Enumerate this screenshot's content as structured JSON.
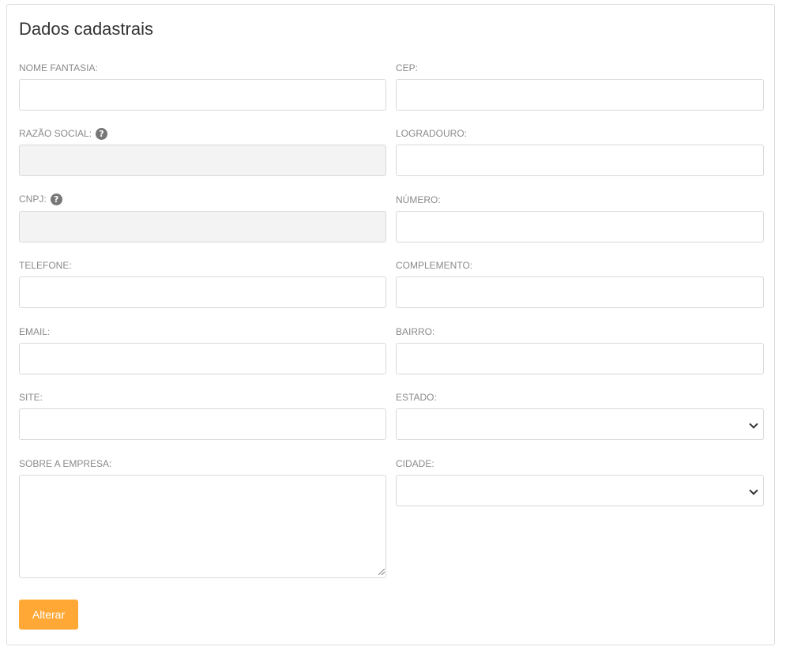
{
  "form": {
    "title": "Dados cadastrais",
    "submit_label": "Alterar",
    "left": {
      "nome_fantasia": {
        "label": "NOME FANTASIA:",
        "value": ""
      },
      "razao_social": {
        "label": "RAZÃO SOCIAL:",
        "value": "",
        "help_icon": "question-circle-icon"
      },
      "cnpj": {
        "label": "CNPJ:",
        "value": "",
        "help_icon": "question-circle-icon"
      },
      "telefone": {
        "label": "TELEFONE:",
        "value": ""
      },
      "email": {
        "label": "EMAIL:",
        "value": ""
      },
      "site": {
        "label": "SITE:",
        "value": ""
      },
      "sobre": {
        "label": "SOBRE A EMPRESA:",
        "value": ""
      }
    },
    "right": {
      "cep": {
        "label": "CEP:",
        "value": ""
      },
      "logradouro": {
        "label": "LOGRADOURO:",
        "value": ""
      },
      "numero": {
        "label": "NÚMERO:",
        "value": ""
      },
      "complemento": {
        "label": "COMPLEMENTO:",
        "value": ""
      },
      "bairro": {
        "label": "BAIRRO:",
        "value": ""
      },
      "estado": {
        "label": "ESTADO:",
        "selected": ""
      },
      "cidade": {
        "label": "CIDADE:",
        "selected": ""
      }
    }
  },
  "colors": {
    "accent": "#ffa836",
    "disabled_bg": "#f3f3f3",
    "border": "#d9d9d9",
    "label": "#8a8a8a"
  }
}
